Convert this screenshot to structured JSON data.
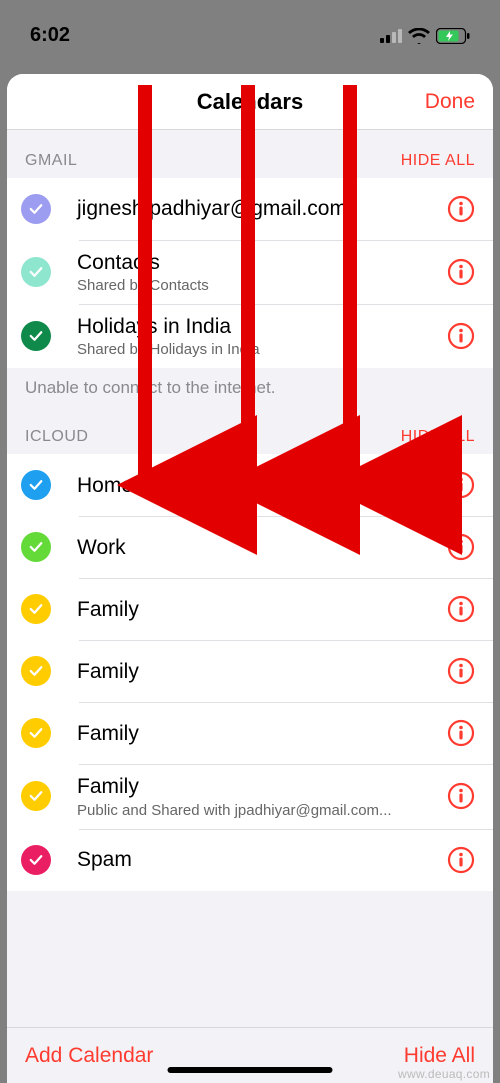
{
  "status": {
    "time": "6:02"
  },
  "sheet": {
    "title": "Calendars",
    "done": "Done"
  },
  "note": "Unable to connect to the internet.",
  "sections": [
    {
      "label": "GMAIL",
      "hide": "HIDE ALL",
      "items": [
        {
          "title": "jignesh.padhiyar@gmail.com",
          "sub": "",
          "color": "#9c9cf0"
        },
        {
          "title": "Contacts",
          "sub": "Shared by Contacts",
          "color": "#8fe6cf"
        },
        {
          "title": "Holidays in India",
          "sub": "Shared by Holidays in India",
          "color": "#0f8a4b"
        }
      ]
    },
    {
      "label": "ICLOUD",
      "hide": "HIDE ALL",
      "items": [
        {
          "title": "Home",
          "sub": "",
          "color": "#1e9ff0"
        },
        {
          "title": "Work",
          "sub": "",
          "color": "#63da38"
        },
        {
          "title": "Family",
          "sub": "",
          "color": "#ffcc00"
        },
        {
          "title": "Family",
          "sub": "",
          "color": "#ffcc00"
        },
        {
          "title": "Family",
          "sub": "",
          "color": "#ffcc00"
        },
        {
          "title": "Family",
          "sub": "Public and Shared with jpadhiyar@gmail.com...",
          "color": "#ffcc00"
        },
        {
          "title": "Spam",
          "sub": "",
          "color": "#e91e63"
        }
      ]
    }
  ],
  "toolbar": {
    "add": "Add Calendar",
    "hideAll": "Hide All"
  },
  "watermark": "www.deuaq.com",
  "accent": "#ff3b30"
}
